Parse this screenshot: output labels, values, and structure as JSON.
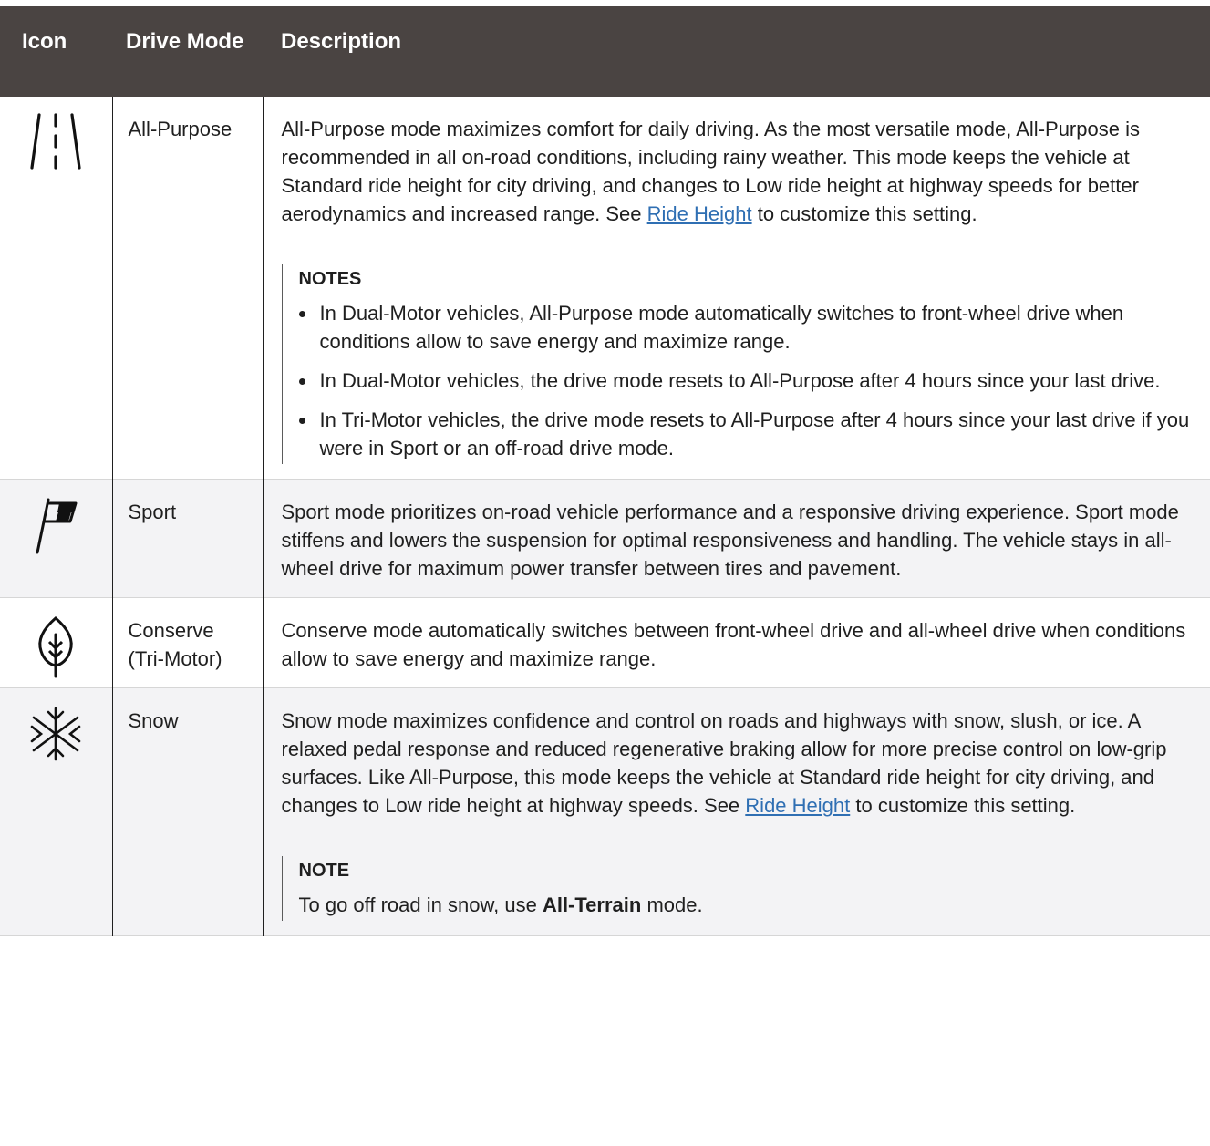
{
  "table": {
    "headers": {
      "icon": "Icon",
      "mode": "Drive Mode",
      "description": "Description"
    },
    "rows": [
      {
        "icon": "road-lanes-icon",
        "mode": "All-Purpose",
        "desc_before": "All-Purpose mode maximizes comfort for daily driving. As the most versatile mode, All-Purpose is recommended in all on-road conditions, including rainy weather. This mode keeps the vehicle at Standard ride height for city driving, and changes to Low ride height at highway speeds for better aerodynamics and increased range. See ",
        "link": "Ride Height",
        "desc_after": " to customize this setting.",
        "notes_title": "NOTES",
        "notes": [
          "In Dual-Motor vehicles, All-Purpose mode automatically switches to front-wheel drive when conditions allow to save energy and maximize range.",
          "In Dual-Motor vehicles, the drive mode resets to All-Purpose after 4 hours since your last drive.",
          "In Tri-Motor vehicles, the drive mode resets to All-Purpose after 4 hours since your last drive if you were in Sport or an off-road drive mode."
        ]
      },
      {
        "icon": "flag-icon",
        "mode": "Sport",
        "desc": "Sport mode prioritizes on-road vehicle performance and a responsive driving experience. Sport mode stiffens and lowers the suspension for optimal responsiveness and handling. The vehicle stays in all-wheel drive for maximum power transfer between tires and pavement."
      },
      {
        "icon": "leaf-icon",
        "mode": "Conserve (Tri-Motor)",
        "desc": "Conserve mode automatically switches between front-wheel drive and all-wheel drive when conditions allow to save energy and maximize range."
      },
      {
        "icon": "snowflake-icon",
        "mode": "Snow",
        "desc_before": "Snow mode maximizes confidence and control on roads and highways with snow, slush, or ice. A relaxed pedal response and reduced regenerative braking allow for more precise control on low-grip surfaces. Like All-Purpose, this mode keeps the vehicle at Standard ride height for city driving, and changes to Low ride height at highway speeds. See ",
        "link": "Ride Height",
        "desc_after": " to customize this setting.",
        "note_title": "NOTE",
        "note_before": "To go off road in snow, use ",
        "note_bold": "All-Terrain",
        "note_after": " mode."
      }
    ]
  }
}
